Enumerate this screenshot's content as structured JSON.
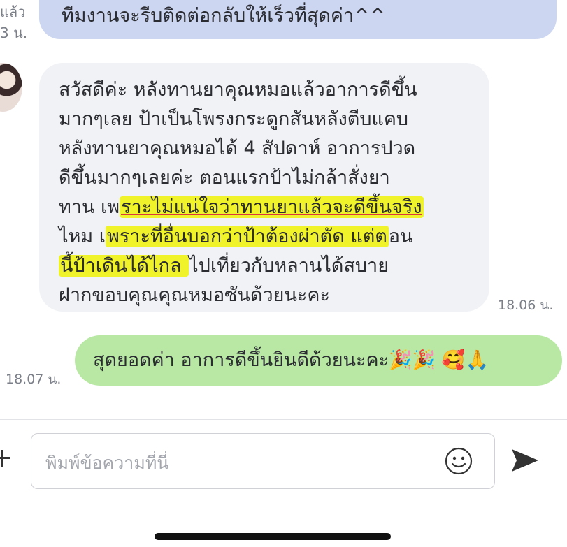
{
  "previous_message": {
    "text": "ทีมงานจะรีบติดต่อกลับให้เร็วที่สุดค่า^^",
    "status_line1": "แล้ว",
    "status_line2": "3 น."
  },
  "incoming_message": {
    "lines": [
      "สวัสดีค่ะ หลังทานยาคุณหมอแล้วอาการดีขึ้น",
      "มากๆเลย ป้าเป็นโพรงกระดูกสันหลังตีบแคบ",
      "หลังทานยาคุณหมอได้ 4 สัปดาห์ อาการปวด",
      "ดีขึ้นมากๆเลยค่ะ ตอนแรกป้าไม่กล้าสั่งยา"
    ],
    "line5_plain": "ทาน  เพ",
    "line5_highlight": "ราะไม่แน่ใจว่าทานยาแล้วจะดีขึ้นจริง",
    "line6_plain": "ไหม  เ",
    "line6_highlight": "พราะที่อื่นบอกว่าป้าต้องผ่าตัด แต่ต",
    "line6_rest": "อน",
    "line7_highlight": "นี้ป้าเดินได้ไกล ",
    "line7_rest": " ไปเที่ยวกับหลานได้สบาย",
    "line8": "ฝากขอบคุณคุณหมอซันด้วยนะคะ",
    "time": "18.06 น.",
    "colors": {
      "bubble": "#f1f2f5",
      "highlight": "#f0f22a"
    }
  },
  "outgoing_reply": {
    "text": "สุดยอดค่า อาการดีขึ้นยินดีด้วยนะคะ🎉🎉 🥰🙏",
    "time": "18.07 น.",
    "colors": {
      "bubble": "#b8e8a4"
    }
  },
  "composer": {
    "placeholder": "พิมพ์ข้อความที่นี่",
    "value": "",
    "icons": [
      "plus-icon",
      "emoji-icon",
      "send-icon"
    ]
  }
}
